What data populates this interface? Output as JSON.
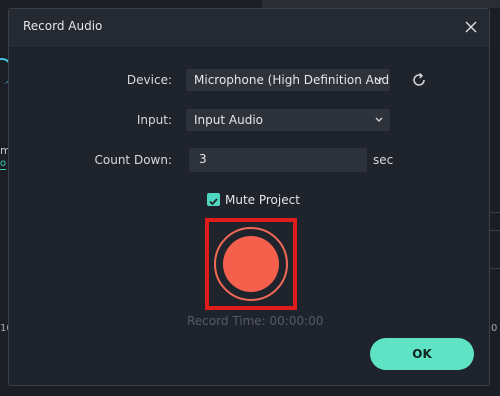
{
  "dialog": {
    "title": "Record Audio",
    "close_icon": "close-icon"
  },
  "device": {
    "label": "Device:",
    "value": "Microphone (High Definition Aud",
    "refresh_icon": "refresh-icon"
  },
  "input": {
    "label": "Input:",
    "value": "Input Audio"
  },
  "countdown": {
    "label": "Count Down:",
    "value": "3",
    "unit": "sec"
  },
  "mute": {
    "label": "Mute Project",
    "checked": true
  },
  "record": {
    "icon": "record-icon",
    "time_text": "Record Time: 00:00:00"
  },
  "ok_label": "OK",
  "background": {
    "left_char": "m",
    "left_link": "o",
    "left_num": "10",
    "right_num": "0"
  },
  "colors": {
    "accent": "#5ee3c4",
    "record": "#f5604d",
    "highlight": "#e01b1b"
  }
}
